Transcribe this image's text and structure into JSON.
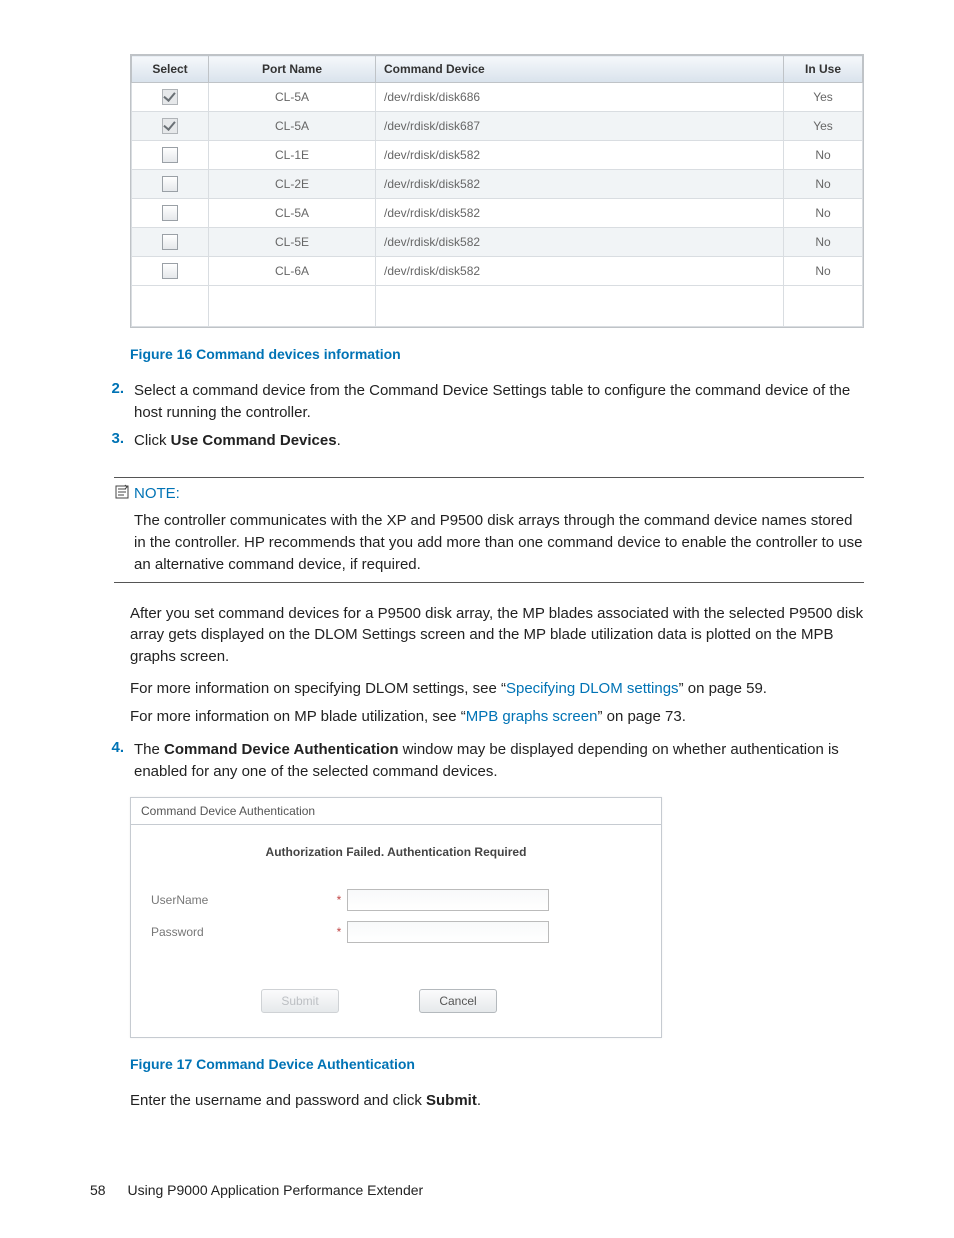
{
  "table": {
    "headers": {
      "select": "Select",
      "port": "Port Name",
      "device": "Command Device",
      "inuse": "In Use"
    },
    "rows": [
      {
        "checked": true,
        "disabled": true,
        "port": "CL-5A",
        "device": "/dev/rdisk/disk686",
        "inuse": "Yes",
        "alt": false
      },
      {
        "checked": true,
        "disabled": true,
        "port": "CL-5A",
        "device": "/dev/rdisk/disk687",
        "inuse": "Yes",
        "alt": true
      },
      {
        "checked": false,
        "disabled": false,
        "port": "CL-1E",
        "device": "/dev/rdisk/disk582",
        "inuse": "No",
        "alt": false
      },
      {
        "checked": false,
        "disabled": false,
        "port": "CL-2E",
        "device": "/dev/rdisk/disk582",
        "inuse": "No",
        "alt": true
      },
      {
        "checked": false,
        "disabled": false,
        "port": "CL-5A",
        "device": "/dev/rdisk/disk582",
        "inuse": "No",
        "alt": false
      },
      {
        "checked": false,
        "disabled": false,
        "port": "CL-5E",
        "device": "/dev/rdisk/disk582",
        "inuse": "No",
        "alt": true
      },
      {
        "checked": false,
        "disabled": false,
        "port": "CL-6A",
        "device": "/dev/rdisk/disk582",
        "inuse": "No",
        "alt": false
      }
    ]
  },
  "captions": {
    "fig16": "Figure 16 Command devices information",
    "fig17": "Figure 17 Command Device Authentication"
  },
  "steps": {
    "s2_num": "2.",
    "s2_text": "Select a command device from the Command Device Settings table to configure the command device of the host running the controller.",
    "s3_num": "3.",
    "s3_pre": "Click ",
    "s3_bold": "Use Command Devices",
    "s3_post": ".",
    "s4_num": "4.",
    "s4_pre": "The ",
    "s4_bold": "Command Device Authentication",
    "s4_post": " window may be displayed depending on whether authentication is enabled for any one of the selected command devices."
  },
  "note": {
    "title": "NOTE:",
    "body": "The controller communicates with the XP and P9500 disk arrays through the command device names stored in the controller. HP recommends that you add more than one command device to enable the controller to use an alternative command device, if required."
  },
  "paras": {
    "p1": "After you set command devices for a P9500 disk array, the MP blades associated with the selected P9500 disk array gets displayed on the DLOM Settings screen and the MP blade utilization data is plotted on the MPB graphs screen.",
    "p2_pre": "For more information on specifying DLOM settings, see “",
    "p2_link": "Specifying DLOM settings",
    "p2_post": "” on page 59.",
    "p3_pre": "For more information on MP blade utilization, see “",
    "p3_link": "MPB graphs screen",
    "p3_post": "” on page 73.",
    "p_end_pre": "Enter the username and password and click ",
    "p_end_bold": "Submit",
    "p_end_post": "."
  },
  "dialog": {
    "title": "Command Device Authentication",
    "message": "Authorization Failed. Authentication Required",
    "user_label": "UserName",
    "pass_label": "Password",
    "req": "*",
    "submit": "Submit",
    "cancel": "Cancel"
  },
  "footer": {
    "page": "58",
    "title": "Using P9000 Application Performance Extender"
  }
}
